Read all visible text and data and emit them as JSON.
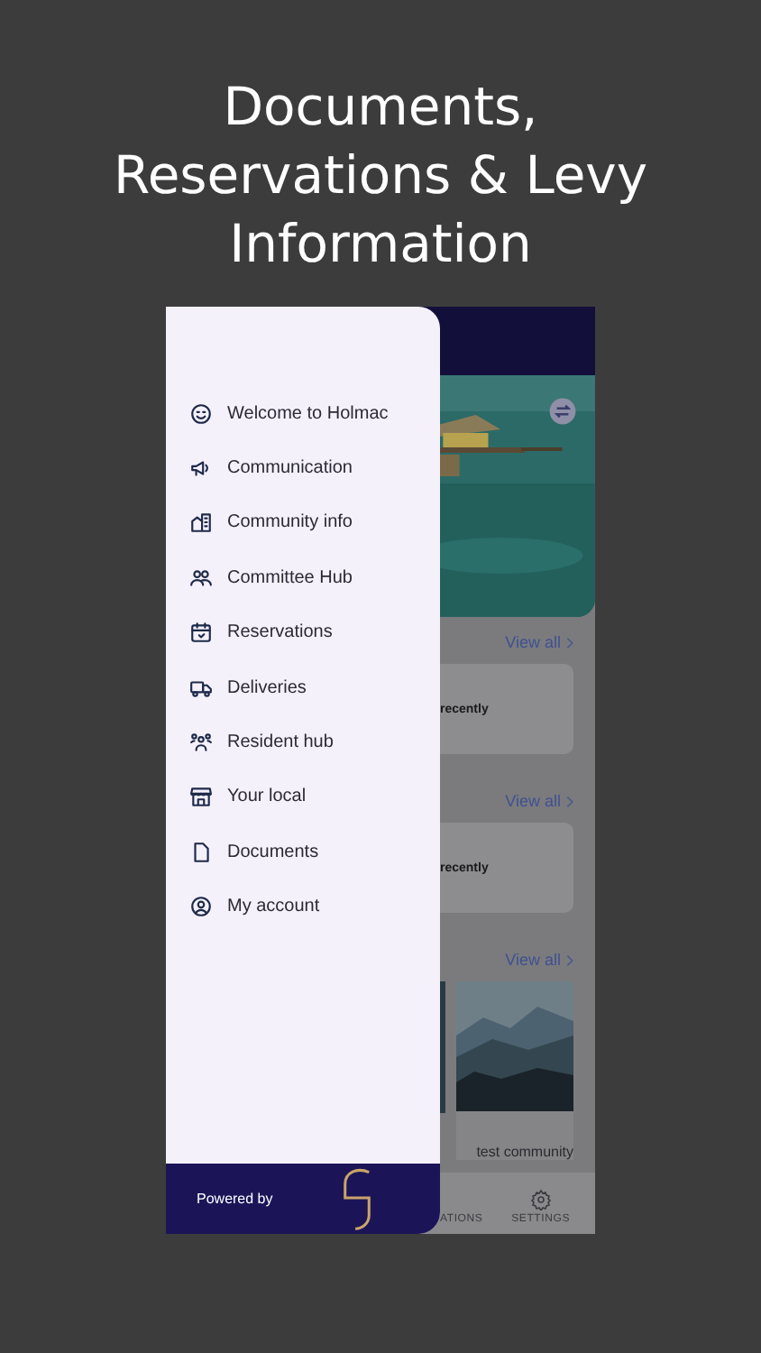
{
  "headline": "Documents, Reservations & Levy Information",
  "drawer": {
    "items": [
      {
        "label": "Welcome to Holmac"
      },
      {
        "label": "Communication"
      },
      {
        "label": "Community info"
      },
      {
        "label": "Committee Hub"
      },
      {
        "label": "Reservations"
      },
      {
        "label": "Deliveries"
      },
      {
        "label": "Resident hub"
      },
      {
        "label": "Your local"
      },
      {
        "label": "Documents"
      },
      {
        "label": "My account"
      }
    ],
    "footer": {
      "text": "Powered by"
    }
  },
  "background_screen": {
    "sections": [
      {
        "link": "View all",
        "card_text": "recently"
      },
      {
        "link": "View all",
        "card_text": "recently"
      },
      {
        "link": "View all",
        "caption": "test community"
      }
    ],
    "nav": [
      {
        "label": "ATIONS"
      },
      {
        "label": "SETTINGS"
      }
    ]
  }
}
